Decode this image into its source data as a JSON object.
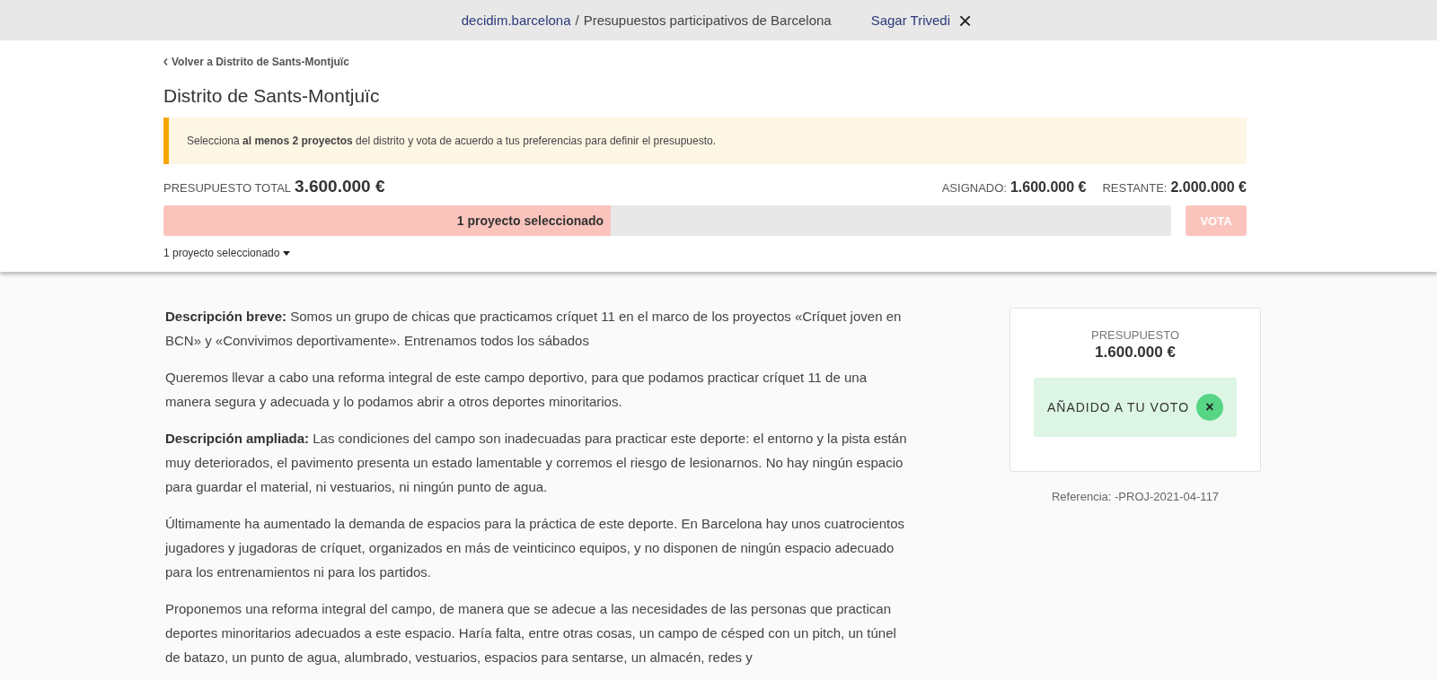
{
  "top_bar": {
    "site_link": "decidim.barcelona",
    "separator": "/",
    "process_title": "Presupuestos participativos de Barcelona",
    "user_link": "Sagar Trivedi",
    "close": "×"
  },
  "header": {
    "back_link": "Volver a Distrito de Sants-Montjuïc",
    "title": "Distrito de Sants-Montjuïc",
    "notice": "Selecciona **al menos 2 proyectos** del distrito y vota de acuerdo a tus preferencias para definir el presupuesto.",
    "total_label": "PRESUPUESTO TOTAL",
    "total_value": "3.600.000 €",
    "assigned_label": "ASIGNADO:",
    "assigned_value": "1.600.000 €",
    "remaining_label": "RESTANTE:",
    "remaining_value": "2.000.000 €",
    "progress": {
      "level": 0.444,
      "label": "1 proyecto seleccionado"
    },
    "vote_button": {
      "label": "VOTA",
      "disabled": true
    },
    "selected_toggle": {
      "label": "1 proyecto seleccionado",
      "expanded": false
    }
  },
  "description": [
    "**Descripción breve:** Somos un grupo de chicas que practicamos críquet 11 en el marco de los proyectos «Críquet joven en BCN» y «Convivimos deportivamente». Entrenamos todos los sábados",
    "Queremos llevar a cabo una reforma integral de este campo deportivo, para que podamos practicar críquet 11 de una manera segura y adecuada y lo podamos abrir a otros deportes minoritarios.",
    "**Descripción ampliada:** Las condiciones del campo son inadecuadas para practicar este deporte: el entorno y la pista están muy deteriorados, el pavimento presenta un estado lamentable y corremos el riesgo de lesionarnos. No hay ningún espacio para guardar el material, ni vestuarios, ni ningún punto de agua.",
    "Últimamente ha aumentado la demanda de espacios para la práctica de este deporte. En Barcelona hay unos cuatrocientos jugadores y jugadoras de críquet, organizados en más de veinticinco equipos, y no disponen de ningún espacio adecuado para los entrenamientos ni para los partidos.",
    "Proponemos una reforma integral del campo, de manera que se adecue a las necesidades de las personas que practican deportes minoritarios adecuados a este espacio. Haría falta, entre otras cosas, un campo de césped con un pitch, un túnel de batazo, un punto de agua, alumbrado, vestuarios, espacios para sentarse, un almacén, redes y"
  ],
  "budget_card": {
    "label": "PRESUPUESTO",
    "value": "1.600.000 €",
    "vote_status": {
      "label": "AÑADIDO A TU VOTO",
      "added": true,
      "remove": "×"
    }
  },
  "reference": "Referencia: -PROJ-2021-04-117"
}
